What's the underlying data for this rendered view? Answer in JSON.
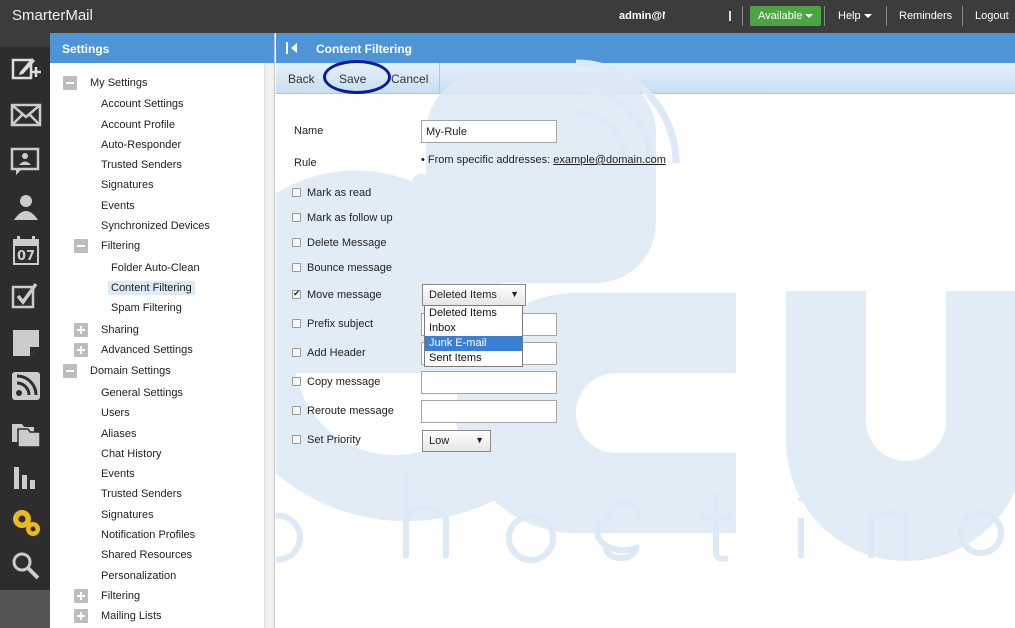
{
  "app": {
    "title": "SmarterMail"
  },
  "topbar": {
    "user": "admin@N",
    "status": "Available",
    "help": "Help",
    "reminders": "Reminders",
    "logout": "Logout"
  },
  "rail": {
    "icons": [
      "compose-icon",
      "mail-icon",
      "chat-icon",
      "contacts-icon",
      "calendar-icon",
      "tasks-icon",
      "notes-icon",
      "rss-icon",
      "files-icon",
      "reports-icon",
      "settings-icon",
      "search-icon"
    ],
    "calendar_day": "07"
  },
  "tree": {
    "title": "Settings",
    "my_settings": "My Settings",
    "account_settings": "Account Settings",
    "account_profile": "Account Profile",
    "auto_responder": "Auto-Responder",
    "trusted_senders": "Trusted Senders",
    "signatures": "Signatures",
    "events": "Events",
    "synchronized_devices": "Synchronized Devices",
    "filtering": "Filtering",
    "folder_auto_clean": "Folder Auto-Clean",
    "content_filtering": "Content Filtering",
    "spam_filtering": "Spam Filtering",
    "sharing": "Sharing",
    "advanced_settings": "Advanced Settings",
    "domain_settings": "Domain Settings",
    "general_settings": "General Settings",
    "users": "Users",
    "aliases": "Aliases",
    "chat_history": "Chat History",
    "d_events": "Events",
    "d_trusted_senders": "Trusted Senders",
    "d_signatures": "Signatures",
    "notification_profiles": "Notification Profiles",
    "shared_resources": "Shared Resources",
    "personalization": "Personalization",
    "d_filtering": "Filtering",
    "mailing_lists": "Mailing Lists"
  },
  "main": {
    "title": "Content Filtering",
    "toolbar": {
      "back": "Back",
      "save": "Save",
      "cancel": "Cancel"
    },
    "form": {
      "name_label": "Name",
      "name_value": "My-Rule",
      "rule_label": "Rule",
      "rule_text": "From specific addresses:",
      "rule_link": "example@domain.com",
      "mark_as_read": "Mark as read",
      "mark_as_follow_up": "Mark as follow up",
      "delete_message": "Delete Message",
      "bounce_message": "Bounce message",
      "move_message": "Move message",
      "move_selected": "Deleted Items",
      "move_options": [
        "Deleted Items",
        "Inbox",
        "Junk E-mail",
        "Sent Items"
      ],
      "move_highlighted": "Junk E-mail",
      "prefix_subject": "Prefix subject",
      "add_header": "Add Header",
      "copy_message": "Copy message",
      "reroute_message": "Reroute message",
      "set_priority": "Set Priority",
      "priority_selected": "Low",
      "move_checked": true
    }
  },
  "colors": {
    "accent": "#4d95d6",
    "available": "#4ca543",
    "highlight": "#3a7fd4",
    "annotation": "#0c1a9c"
  }
}
